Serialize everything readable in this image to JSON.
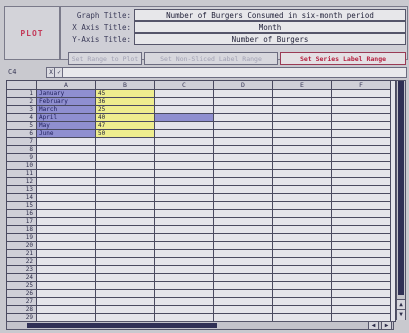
{
  "plot_label": "PLOT",
  "graph": {
    "title_label": "Graph Title:",
    "title_value": "Number of Burgers Consumed in six-month period",
    "x_label": "X Axis Title:",
    "x_value": "Month",
    "y_label": "Y-Axis Title:",
    "y_value": "Number of Burgers"
  },
  "buttons": {
    "b1": "Set Range to Plot",
    "b2": "Set Non-Sliced Label Range",
    "b3": "Set Series Label Range"
  },
  "cell_ref": "C4",
  "edit_buttons": [
    "X",
    "✓"
  ],
  "columns": [
    "A",
    "B",
    "C",
    "D",
    "E",
    "F"
  ],
  "rows": [
    "1",
    "2",
    "3",
    "4",
    "5",
    "6",
    "7",
    "8",
    "9",
    "10",
    "11",
    "12",
    "13",
    "14",
    "15",
    "16",
    "17",
    "18",
    "19",
    "20",
    "21",
    "22",
    "23",
    "24",
    "25",
    "26",
    "27",
    "28",
    "29"
  ],
  "data": {
    "months": [
      "January",
      "February",
      "March",
      "April",
      "May",
      "June"
    ],
    "values": [
      "45",
      "36",
      "25",
      "40",
      "47",
      "50"
    ]
  },
  "colors": {
    "month_fill": "#8f8fd0",
    "value_fill": "#eeed8e",
    "active_button_text": "#b5203f"
  }
}
